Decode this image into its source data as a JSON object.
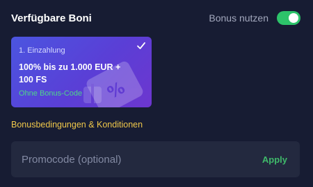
{
  "header": {
    "title": "Verfügbare Boni",
    "toggle_label": "Bonus nutzen",
    "toggle_on": true
  },
  "bonus_card": {
    "step": "1. Einzahlung",
    "offer": "100% bis zu 1.000 EUR + 100 FS",
    "code_note": "Ohne Bonus-Code",
    "selected": true
  },
  "terms_link": "Bonusbedingungen & Konditionen",
  "promo": {
    "placeholder": "Promocode (optional)",
    "value": "",
    "apply_label": "Apply"
  },
  "colors": {
    "background": "#171c33",
    "toggle_green": "#2dc36a",
    "terms_yellow": "#f0c84a",
    "apply_green": "#3fb96a",
    "code_green": "#4fd48a"
  }
}
